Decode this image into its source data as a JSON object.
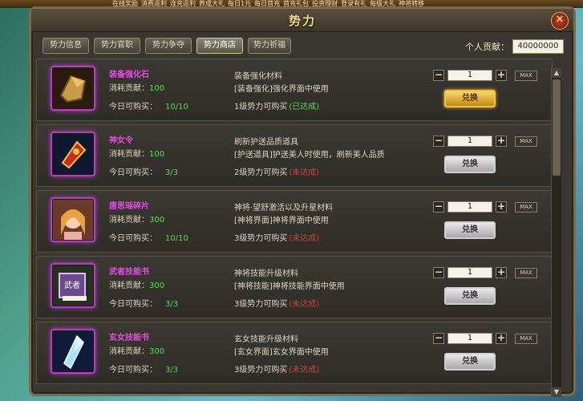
{
  "title": "势力",
  "top_bar": [
    "在线奖励",
    "消费返利",
    "连充返利",
    "养成大礼",
    "每日1元",
    "每日首充",
    "首充礼包",
    "投资理财",
    "登录有礼",
    "每级大礼",
    "神将转移"
  ],
  "bottom_bar": "",
  "tabs": [
    {
      "label": "势力信息",
      "active": false
    },
    {
      "label": "势力官职",
      "active": false
    },
    {
      "label": "势力争夺",
      "active": false
    },
    {
      "label": "势力商店",
      "active": true
    },
    {
      "label": "势力祈福",
      "active": false
    }
  ],
  "contribution": {
    "label": "个人贡献：",
    "value": "40000000"
  },
  "labels": {
    "cost": "消耗贡献：",
    "daily": "今日可购买：",
    "max": "MAX",
    "exchange": "兑换",
    "minus": "−",
    "plus": "+",
    "close": "✕"
  },
  "items": [
    {
      "name": "装备强化石",
      "cost": "100",
      "daily": "10/10",
      "desc1": "装备强化材料",
      "desc2": "[装备强化]强化界面中使用",
      "req": "1级势力可购买",
      "status": "(已达成)",
      "done": true,
      "qty": "1",
      "icon": "stone-icon"
    },
    {
      "name": "神女令",
      "cost": "100",
      "daily": "3/3",
      "desc1": "刷新护送品质道具",
      "desc2": "[护送道具]护送美人时使用，刷新美人品质",
      "req": "2级势力可购买",
      "status": "(未达成)",
      "done": false,
      "qty": "1",
      "icon": "token-icon"
    },
    {
      "name": "唐思瑶碎片",
      "cost": "300",
      "daily": "10/10",
      "desc1": "神将·望舒激活以及升星材料",
      "desc2": "[神将界面]神将界面中使用",
      "req": "3级势力可购买",
      "status": "(未达成)",
      "done": false,
      "qty": "1",
      "icon": "portrait-icon"
    },
    {
      "name": "武者技能书",
      "cost": "300",
      "daily": "3/3",
      "desc1": "神将技能升级材料",
      "desc2": "[神将技能]神将技能界面中使用",
      "req": "3级势力可购买",
      "status": "(未达成)",
      "done": false,
      "qty": "1",
      "icon": "book-icon"
    },
    {
      "name": "玄女技能书",
      "cost": "300",
      "daily": "3/3",
      "desc1": "玄女技能升级材料",
      "desc2": "[玄女界面]玄女界面中使用",
      "req": "3级势力可购买",
      "status": "(未达成)",
      "done": false,
      "qty": "1",
      "icon": "crystal-icon"
    }
  ],
  "scroll": {
    "up": "▲",
    "down": "▼"
  }
}
